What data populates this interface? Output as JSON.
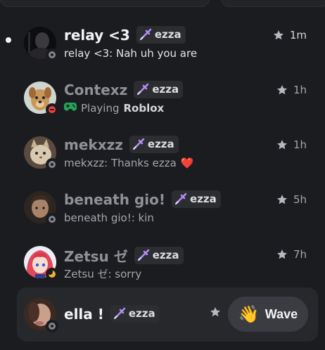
{
  "dms": [
    {
      "name": "relay <3",
      "tag": "ezza",
      "preview": "relay <3: Nah uh you are",
      "time": "1m",
      "status": "offline",
      "unread": true,
      "avatar_icon": "dark-figure-avatar"
    },
    {
      "name": "Contexz",
      "tag": "ezza",
      "activity_prefix": "Playing",
      "activity_game": "Roblox",
      "activity_icon": "gamepad-icon",
      "time": "1h",
      "status": "dnd",
      "avatar_icon": "dog-avatar"
    },
    {
      "name": "mekxzz",
      "tag": "ezza",
      "preview": "mekxzz: Thanks ezza",
      "preview_emoji": "❤️",
      "time": "1h",
      "status": "offline",
      "avatar_icon": "cat-avatar"
    },
    {
      "name": "beneath gio!",
      "tag": "ezza",
      "preview": "beneath gio!: kin",
      "time": "5h",
      "status": "offline",
      "avatar_icon": "person-avatar"
    },
    {
      "name": "Zetsu ゼ",
      "tag": "ezza",
      "preview": "Zetsu ゼ: sorry",
      "time": "7h",
      "status": "idle",
      "avatar_icon": "anime-girl-avatar"
    }
  ],
  "last": {
    "name": "ella !",
    "tag": "ezza",
    "status": "offline",
    "avatar_icon": "blurry-face-avatar",
    "wave_emoji": "👋",
    "wave_label": "Wave"
  },
  "colors": {
    "background": "#1b1c1f",
    "card": "#27282c",
    "tag_bg": "#2b2d31",
    "sword_purple": "#b48cf2",
    "status_offline": "#80848e",
    "status_dnd": "#f23f43",
    "status_idle": "#f0b232"
  }
}
